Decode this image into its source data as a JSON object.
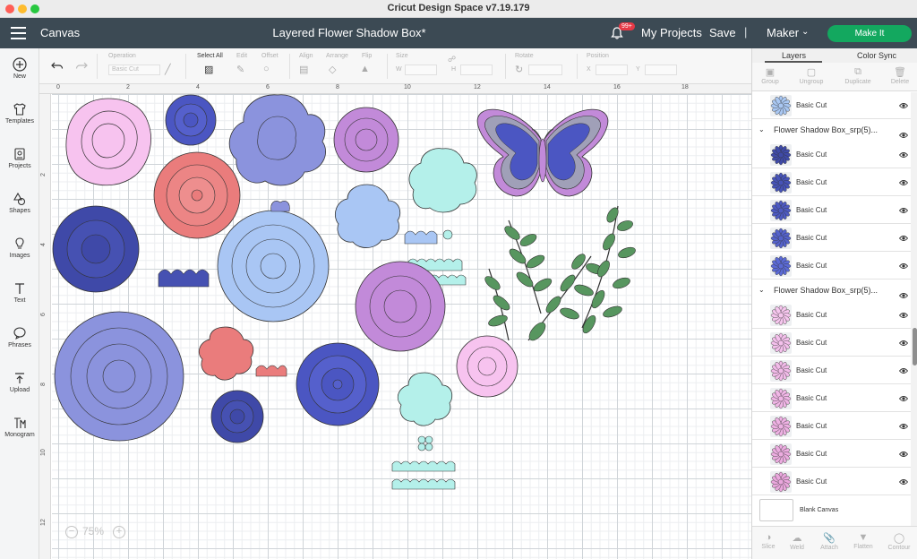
{
  "window": {
    "title": "Cricut Design Space  v7.19.179"
  },
  "header": {
    "canvas_label": "Canvas",
    "project_title": "Layered Flower Shadow Box*",
    "notification_count": "99+",
    "my_projects": "My Projects",
    "save": "Save",
    "separator": "|",
    "machine": "Maker",
    "make_it": "Make It"
  },
  "sidebar": {
    "items": [
      {
        "label": "New",
        "icon": "plus-icon"
      },
      {
        "label": "Templates",
        "icon": "shirt-icon"
      },
      {
        "label": "Projects",
        "icon": "projects-icon"
      },
      {
        "label": "Shapes",
        "icon": "shapes-icon"
      },
      {
        "label": "Images",
        "icon": "bulb-icon"
      },
      {
        "label": "Text",
        "icon": "text-icon"
      },
      {
        "label": "Phrases",
        "icon": "speech-icon"
      },
      {
        "label": "Upload",
        "icon": "upload-icon"
      },
      {
        "label": "Monogram",
        "icon": "monogram-icon"
      }
    ]
  },
  "toolbar": {
    "operation_label": "Operation",
    "operation_value": "Basic Cut",
    "select_all": "Select All",
    "edit": "Edit",
    "offset": "Offset",
    "align": "Align",
    "arrange": "Arrange",
    "flip": "Flip",
    "size": "Size",
    "w": "W",
    "h": "H",
    "rotate": "Rotate",
    "position": "Position",
    "x": "X",
    "y": "Y"
  },
  "ruler": {
    "top": [
      "0",
      "2",
      "4",
      "6",
      "8",
      "10",
      "12",
      "14",
      "16",
      "18"
    ],
    "left": [
      "2",
      "4",
      "6",
      "8",
      "10",
      "12"
    ]
  },
  "zoom": {
    "minus": "−",
    "value": "75%",
    "plus": "+"
  },
  "panel": {
    "tabs": [
      "Layers",
      "Color Sync"
    ],
    "actions": [
      "Group",
      "Ungroup",
      "Duplicate",
      "Delete"
    ],
    "layers": [
      {
        "type": "layer",
        "name": "Basic Cut",
        "color": "#a9c7f2"
      },
      {
        "type": "group",
        "name": "Flower Shadow Box_srp(5)..."
      },
      {
        "type": "layer",
        "name": "Basic Cut",
        "color": "#3f4aa8"
      },
      {
        "type": "layer",
        "name": "Basic Cut",
        "color": "#4653b8"
      },
      {
        "type": "layer",
        "name": "Basic Cut",
        "color": "#4d5ac2"
      },
      {
        "type": "layer",
        "name": "Basic Cut",
        "color": "#5462cb"
      },
      {
        "type": "layer",
        "name": "Basic Cut",
        "color": "#5b6ad6"
      },
      {
        "type": "group",
        "name": "Flower Shadow Box_srp(5)..."
      },
      {
        "type": "layer",
        "name": "Basic Cut",
        "color": "#f6c6ee"
      },
      {
        "type": "layer",
        "name": "Basic Cut",
        "color": "#f4c0ec"
      },
      {
        "type": "layer",
        "name": "Basic Cut",
        "color": "#f2bbe9"
      },
      {
        "type": "layer",
        "name": "Basic Cut",
        "color": "#f0b6e6"
      },
      {
        "type": "layer",
        "name": "Basic Cut",
        "color": "#eeb1e3"
      },
      {
        "type": "layer",
        "name": "Basic Cut",
        "color": "#ecace0"
      },
      {
        "type": "layer",
        "name": "Basic Cut",
        "color": "#eaa7dd"
      }
    ],
    "blank_canvas": "Blank Canvas",
    "bottom_actions": [
      "Slice",
      "Weld",
      "Attach",
      "Flatten",
      "Contour"
    ]
  }
}
